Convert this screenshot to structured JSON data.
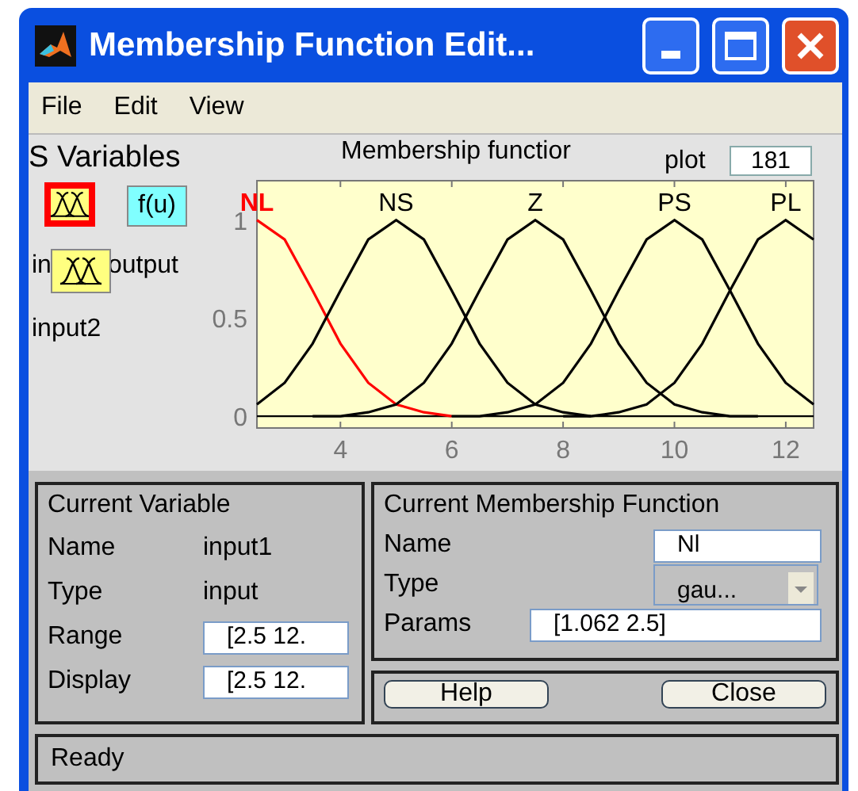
{
  "window": {
    "title": "Membership Function Edit..."
  },
  "menu": [
    "File",
    "Edit",
    "View"
  ],
  "variables_panel": {
    "title": "S Variables",
    "items": [
      {
        "label": "in",
        "kind": "input",
        "selected": true
      },
      {
        "label": "output",
        "kind": "output",
        "icon_text": "f(u)",
        "selected": false
      },
      {
        "label": "input2",
        "kind": "input",
        "selected": false
      }
    ]
  },
  "plot_panel": {
    "title": "Membership functior",
    "plot_label": "plot",
    "plot_points": "181",
    "chart_data": {
      "type": "line",
      "xlim": [
        2.5,
        12.5
      ],
      "ylim": [
        -0.06,
        1.2
      ],
      "xticks": [
        4,
        6,
        8,
        10,
        12
      ],
      "yticks": [
        0,
        0.5,
        1
      ],
      "x": [
        2.5,
        3,
        3.5,
        4,
        4.5,
        5,
        5.5,
        6,
        6.5,
        7,
        7.5,
        8,
        8.5,
        9,
        9.5,
        10,
        10.5,
        11,
        11.5,
        12,
        12.5
      ],
      "series": [
        {
          "name": "NL",
          "color": "#ff0000",
          "values": [
            1,
            0.9,
            0.64,
            0.37,
            0.17,
            0.06,
            0.02,
            0,
            null,
            null,
            null,
            null,
            null,
            null,
            null,
            null,
            null,
            null,
            null,
            null,
            null
          ]
        },
        {
          "name": "NS",
          "color": "#000000",
          "values": [
            0.06,
            0.17,
            0.37,
            0.64,
            0.9,
            1,
            0.9,
            0.64,
            0.37,
            0.17,
            0.06,
            0.02,
            0,
            null,
            null,
            null,
            null,
            null,
            null,
            null,
            null
          ]
        },
        {
          "name": "Z",
          "color": "#000000",
          "values": [
            null,
            null,
            0,
            0,
            0.02,
            0.06,
            0.17,
            0.37,
            0.64,
            0.9,
            1,
            0.9,
            0.64,
            0.37,
            0.17,
            0.06,
            0.02,
            0,
            0,
            null,
            null
          ]
        },
        {
          "name": "PS",
          "color": "#000000",
          "values": [
            null,
            null,
            null,
            null,
            null,
            null,
            null,
            0,
            0,
            0.02,
            0.06,
            0.17,
            0.37,
            0.64,
            0.9,
            1,
            0.9,
            0.64,
            0.37,
            0.17,
            0.06
          ]
        },
        {
          "name": "PL",
          "color": "#000000",
          "values": [
            null,
            null,
            null,
            null,
            null,
            null,
            null,
            null,
            null,
            null,
            null,
            0,
            0,
            0.02,
            0.06,
            0.17,
            0.37,
            0.64,
            0.9,
            1,
            0.9
          ]
        }
      ]
    }
  },
  "current_variable": {
    "title": "Current Variable",
    "rows": [
      {
        "label": "Name",
        "value": "input1",
        "kind": "text"
      },
      {
        "label": "Type",
        "value": "input",
        "kind": "text"
      },
      {
        "label": "Range",
        "value": "[2.5 12.",
        "kind": "field"
      },
      {
        "label": "Display",
        "value": "[2.5 12.",
        "kind": "field"
      }
    ]
  },
  "current_mf": {
    "title": "Current Membership Function",
    "name_label": "Name",
    "name_value": "Nl",
    "type_label": "Type",
    "type_value": "gau...",
    "params_label": "Params",
    "params_value": "[1.062 2.5]"
  },
  "buttons": [
    "Help",
    "Close"
  ],
  "status": "Ready"
}
